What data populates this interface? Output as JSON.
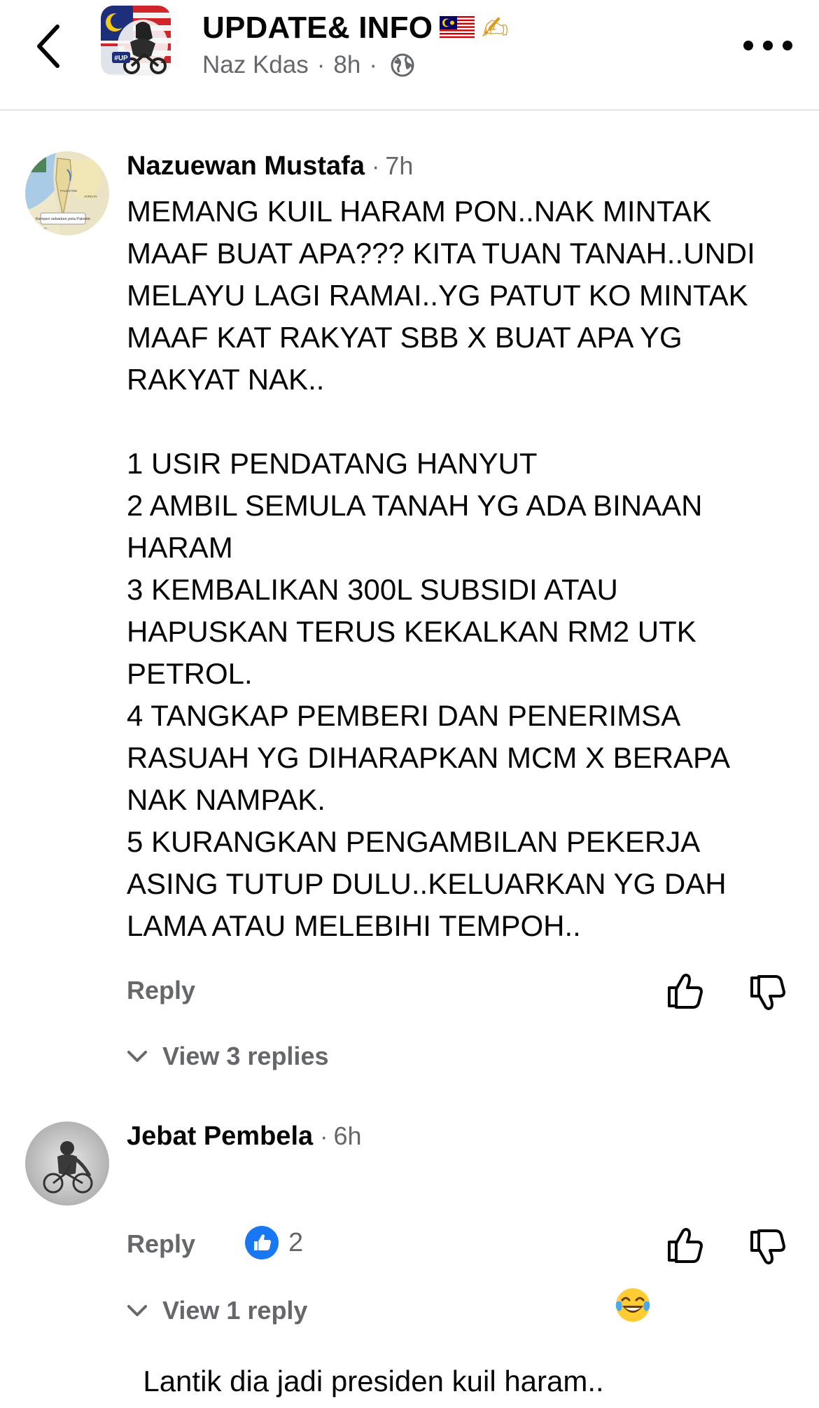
{
  "header": {
    "group_name": "UPDATE& INFO",
    "poster_name": "Naz Kdas",
    "post_age": "8h",
    "separator": "·",
    "icons": {
      "back": "chevron-left-icon",
      "flag": "malaysia-flag-icon",
      "writing": "writing-hand-icon",
      "privacy": "globe-icon",
      "more": "more-options-icon"
    }
  },
  "comments": [
    {
      "author": "Nazuewan Mustafa",
      "time": "7h",
      "separator": "·",
      "text": "MEMANG KUIL HARAM PON..NAK MINTAK\nMAAF BUAT APA??? KITA TUAN TANAH..UNDI\nMELAYU LAGI RAMAI..YG PATUT KO MINTAK\nMAAF KAT RAKYAT SBB X BUAT APA YG\nRAKYAT NAK..\n\n1 USIR PENDATANG HANYUT\n2 AMBIL SEMULA TANAH YG ADA BINAAN\nHARAM\n3 KEMBALIKAN 300L SUBSIDI ATAU\nHAPUSKAN TERUS KEKALKAN RM2 UTK\nPETROL.\n4 TANGKAP PEMBERI DAN PENERIMSA\nRASUAH YG DIHARAPKAN MCM X BERAPA\nNAK NAMPAK.\n5 KURANGKAN PENGAMBILAN PEKERJA\nASING TUTUP DULU..KELUARKAN YG DAH\nLAMA ATAU MELEBIHI TEMPOH..",
      "reply_label": "Reply",
      "view_replies": "View 3 replies",
      "avatar_caption": "Kempen sebarkan peta Palestin",
      "map_labels": [
        "PALESTINE",
        "JORDAN",
        "EGYPT"
      ]
    },
    {
      "author": "Jebat Pembela",
      "time": "6h",
      "separator": "·",
      "text": "Lantik dia jadi presiden kuil haram..",
      "emoji": "face-with-tears-of-joy",
      "reply_label": "Reply",
      "like_count": "2",
      "view_replies": "View 1 reply"
    }
  ],
  "colors": {
    "text_primary": "#050505",
    "text_secondary": "#65676b",
    "like_blue": "#1877f2",
    "divider": "#e4e6eb"
  }
}
